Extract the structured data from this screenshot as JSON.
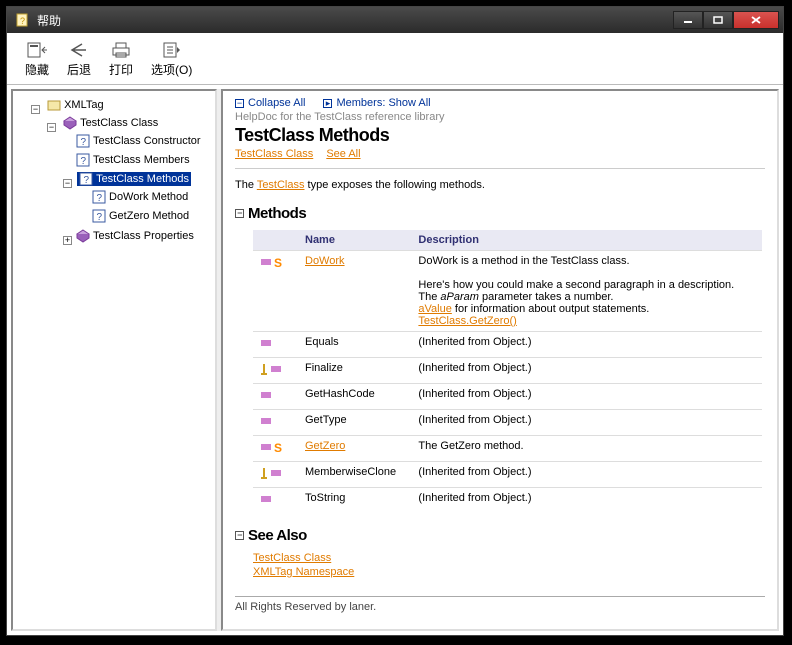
{
  "window": {
    "title": "帮助"
  },
  "toolbar": {
    "hide": "隐藏",
    "back": "后退",
    "print": "打印",
    "options": "选项(O)"
  },
  "tree": {
    "root": "XMLTag",
    "class": "TestClass Class",
    "ctor": "TestClass Constructor",
    "members": "TestClass Members",
    "methods": "TestClass Methods",
    "dowork": "DoWork Method",
    "getzero": "GetZero Method",
    "props": "TestClass Properties"
  },
  "top": {
    "collapse": "Collapse All",
    "membersShow": "Members: Show All"
  },
  "page": {
    "subtitle": "HelpDoc for the TestClass reference library",
    "title": "TestClass Methods",
    "crumbClass": "TestClass Class",
    "crumbSeeAlso": "See All"
  },
  "intro": {
    "pre": "The ",
    "link": "TestClass",
    "post": " type exposes the following methods."
  },
  "sections": {
    "methods": "Methods",
    "seealso": "See Also"
  },
  "table": {
    "hName": "Name",
    "hDesc": "Description",
    "r1n": "DoWork",
    "r1d1": "DoWork is a method in the TestClass class.",
    "r1d2": "Here's how you could make a second paragraph in a description.",
    "r1d3a": "The ",
    "r1d3p": "aParam",
    "r1d3b": " parameter takes a number.",
    "r1d4l": "aValue",
    "r1d4t": " for information about output statements.",
    "r1d5l": "TestClass.GetZero()",
    "r2n": "Equals",
    "r2d": "(Inherited from Object.)",
    "r3n": "Finalize",
    "r3d": "(Inherited from Object.)",
    "r4n": "GetHashCode",
    "r4d": "(Inherited from Object.)",
    "r5n": "GetType",
    "r5d": "(Inherited from Object.)",
    "r6n": "GetZero",
    "r6d": "The GetZero method.",
    "r7n": "MemberwiseClone",
    "r7d": "(Inherited from Object.)",
    "r8n": "ToString",
    "r8d": "(Inherited from Object.)"
  },
  "seealso": {
    "l1": "TestClass Class",
    "l2": "XMLTag Namespace"
  },
  "footer": "All Rights Reserved by laner."
}
